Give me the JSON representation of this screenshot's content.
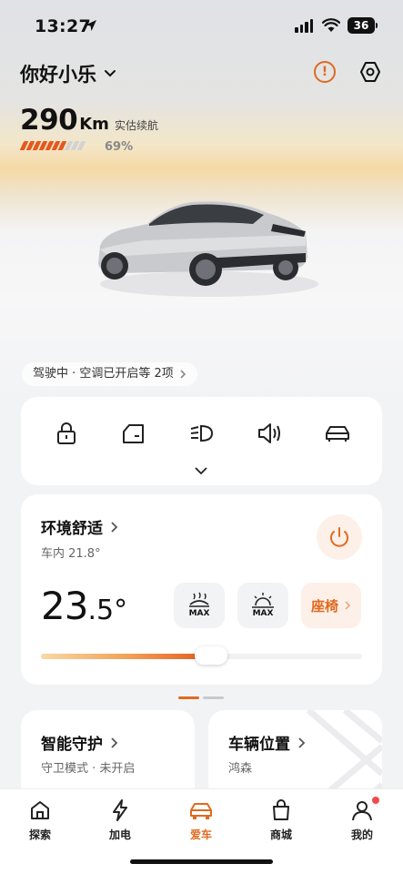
{
  "status_bar": {
    "time": "13:27",
    "battery": "36"
  },
  "header": {
    "greeting": "你好小乐",
    "alert_icon": "alert-circle-icon",
    "settings_icon": "settings-hex-icon"
  },
  "range": {
    "value": "290",
    "unit": "Km",
    "label": "实估续航",
    "percent_text": "69%",
    "percent_value": 0.69
  },
  "drive_status": "驾驶中 · 空调已开启等 2项",
  "controls": [
    "lock-icon",
    "trunk-icon",
    "headlight-icon",
    "horn-icon",
    "car-body-icon"
  ],
  "comfort": {
    "title": "环境舒适",
    "inside_temp": "车内 21.8°",
    "temp_int": "23",
    "temp_dec": ".5",
    "temp_unit": "°",
    "max_front_label": "MAX",
    "max_rear_label": "MAX",
    "seat_label": "座椅",
    "slider_level": 0.53
  },
  "cards": {
    "guard": {
      "title": "智能守护",
      "subtitle": "守卫模式 · 未开启"
    },
    "location": {
      "title": "车辆位置",
      "subtitle": "鸿森"
    }
  },
  "tabs": [
    {
      "label": "探索",
      "icon": "home-icon"
    },
    {
      "label": "加电",
      "icon": "lightning-icon"
    },
    {
      "label": "爱车",
      "icon": "car-icon"
    },
    {
      "label": "商城",
      "icon": "bag-icon"
    },
    {
      "label": "我的",
      "icon": "person-icon"
    }
  ],
  "colors": {
    "accent": "#e06a1f",
    "background": "#f2f3f5",
    "card": "#ffffff"
  }
}
